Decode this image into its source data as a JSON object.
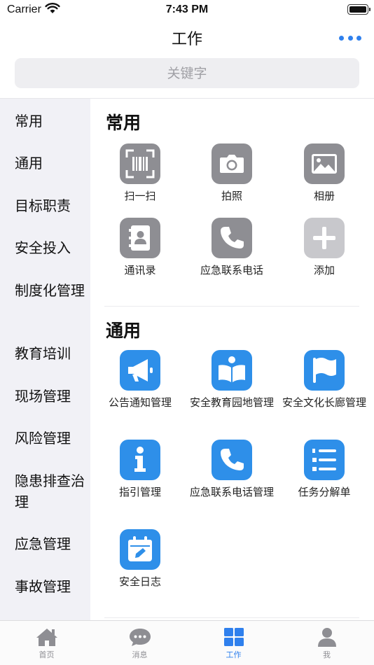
{
  "status": {
    "carrier": "Carrier",
    "time": "7:43 PM"
  },
  "nav": {
    "title": "工作"
  },
  "search": {
    "placeholder": "关键字"
  },
  "sidebar": {
    "items": [
      {
        "label": "常用"
      },
      {
        "label": "通用"
      },
      {
        "label": "目标职责"
      },
      {
        "label": "安全投入"
      },
      {
        "label": "制度化管理"
      },
      {
        "label": "教育培训"
      },
      {
        "label": "现场管理"
      },
      {
        "label": "风险管理"
      },
      {
        "label": "隐患排查治理"
      },
      {
        "label": "应急管理"
      },
      {
        "label": "事故管理"
      }
    ]
  },
  "sections": [
    {
      "title": "常用",
      "tiles": [
        {
          "label": "扫一扫",
          "icon": "barcode-scan-icon"
        },
        {
          "label": "拍照",
          "icon": "camera-icon"
        },
        {
          "label": "相册",
          "icon": "image-icon"
        },
        {
          "label": "通讯录",
          "icon": "contacts-book-icon"
        },
        {
          "label": "应急联系电话",
          "icon": "phone-icon"
        },
        {
          "label": "添加",
          "icon": "plus-icon"
        }
      ]
    },
    {
      "title": "通用",
      "tiles": [
        {
          "label": "公告通知管理",
          "icon": "megaphone-icon"
        },
        {
          "label": "安全教育园地管理",
          "icon": "reading-book-icon"
        },
        {
          "label": "安全文化长廊管理",
          "icon": "flag-icon"
        },
        {
          "label": "指引管理",
          "icon": "info-icon"
        },
        {
          "label": "应急联系电话管理",
          "icon": "phone-icon"
        },
        {
          "label": "任务分解单",
          "icon": "numbered-list-icon"
        },
        {
          "label": "安全日志",
          "icon": "calendar-edit-icon"
        }
      ]
    }
  ],
  "tabbar": {
    "tabs": [
      {
        "label": "首页",
        "icon": "home-icon"
      },
      {
        "label": "消息",
        "icon": "chat-bubble-icon"
      },
      {
        "label": "工作",
        "icon": "grid-icon",
        "active": true
      },
      {
        "label": "我",
        "icon": "user-icon"
      }
    ]
  },
  "colors": {
    "accent": "#2f80ed",
    "tile_blue": "#2e8fe9",
    "tile_gray": "#8e8e93",
    "sidebar_bg": "#f1f1f6"
  }
}
